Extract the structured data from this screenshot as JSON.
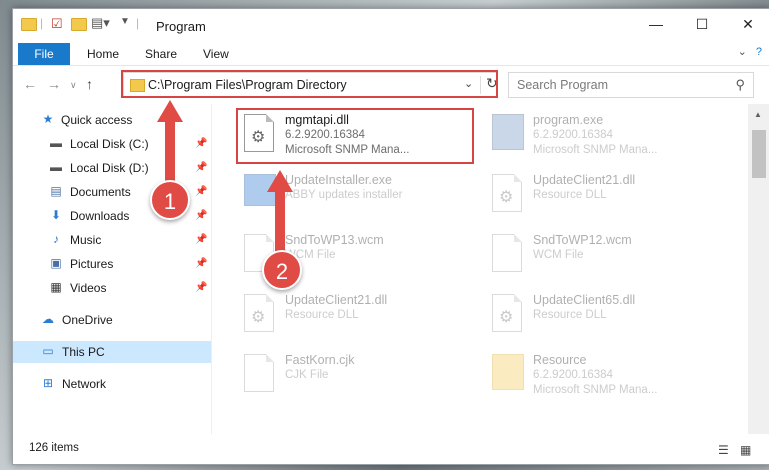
{
  "window": {
    "title": "Program",
    "minimize": "—",
    "maximize": "☐",
    "close": "✕"
  },
  "ribbon": {
    "tabs": [
      "File",
      "Home",
      "Share",
      "View"
    ]
  },
  "address": {
    "path": "C:\\Program Files\\Program Directory",
    "search_placeholder": "Search Program"
  },
  "nav": {
    "items": [
      {
        "label": "Quick access",
        "icon": "star-icon"
      },
      {
        "label": "Local Disk (C:)",
        "icon": "drive-icon"
      },
      {
        "label": "Local Disk (D:)",
        "icon": "drive-icon"
      },
      {
        "label": "Documents",
        "icon": "documents-icon"
      },
      {
        "label": "Downloads",
        "icon": "download-icon"
      },
      {
        "label": "Music",
        "icon": "music-icon"
      },
      {
        "label": "Pictures",
        "icon": "pictures-icon"
      },
      {
        "label": "Videos",
        "icon": "videos-icon"
      },
      {
        "label": "OneDrive",
        "icon": "onedrive-icon"
      },
      {
        "label": "This PC",
        "icon": "pc-icon"
      },
      {
        "label": "Network",
        "icon": "network-icon"
      }
    ]
  },
  "files": [
    {
      "name": "mgmtapi.dll",
      "line1": "6.2.9200.16384",
      "line2": "Microsoft SNMP Mana..."
    },
    {
      "name": "program.exe",
      "line1": "6.2.9200.16384",
      "line2": "Microsoft SNMP Mana..."
    },
    {
      "name": "UpdateInstaller.exe",
      "line1": "ABBY updates installer",
      "line2": ""
    },
    {
      "name": "UpdateClient21.dll",
      "line1": "Resource DLL",
      "line2": ""
    },
    {
      "name": "SndToWP13.wcm",
      "line1": "WCM File",
      "line2": ""
    },
    {
      "name": "SndToWP12.wcm",
      "line1": "WCM File",
      "line2": ""
    },
    {
      "name": "UpdateClient21.dll",
      "line1": "Resource DLL",
      "line2": ""
    },
    {
      "name": "UpdateClient65.dll",
      "line1": "Resource DLL",
      "line2": ""
    },
    {
      "name": "FastKorn.cjk",
      "line1": "CJK File",
      "line2": ""
    },
    {
      "name": "Resource",
      "line1": "6.2.9200.16384",
      "line2": "Microsoft SNMP Mana..."
    }
  ],
  "status": {
    "item_count": "126 items"
  },
  "callouts": {
    "one": "1",
    "two": "2"
  },
  "colors": {
    "accent": "#1979ca",
    "highlight": "#d64541",
    "callout": "#e04b45",
    "selected": "#cce8ff"
  }
}
